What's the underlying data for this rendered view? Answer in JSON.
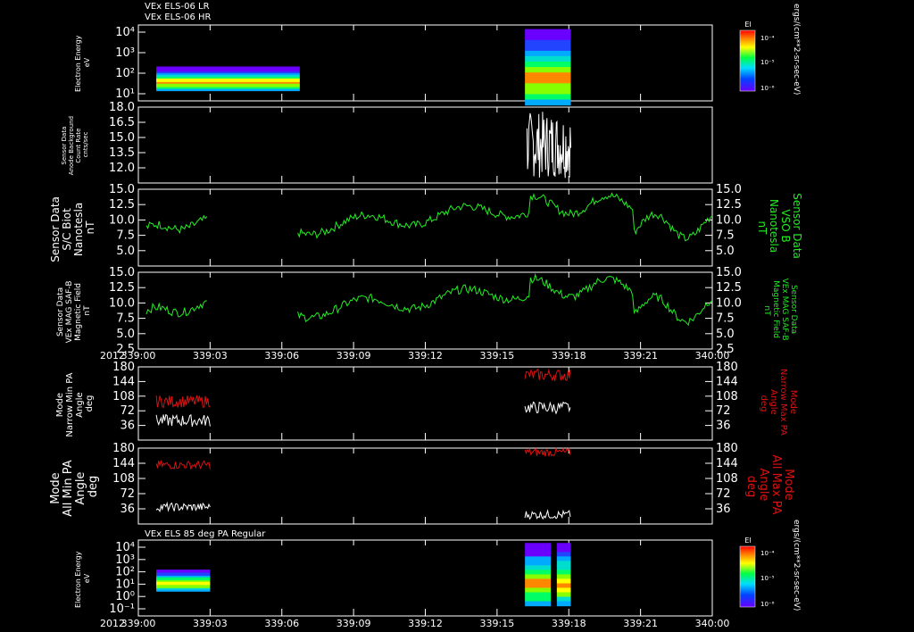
{
  "header": {
    "line1": "VEx ELS-06 LR",
    "line2": "VEx ELS-06 HR"
  },
  "colors": {
    "background": "#000000",
    "axis": "#ffffff",
    "bfield": "#22ee22",
    "min_pa": "#ffffff",
    "max_pa": "#dd1111"
  },
  "time_axis": {
    "year": "2012",
    "ticks": [
      "339:00",
      "339:03",
      "339:06",
      "339:09",
      "339:12",
      "339:15",
      "339:18",
      "339:21",
      "340:00"
    ]
  },
  "chart_data": [
    {
      "id": "spec-top",
      "type": "heatmap",
      "ylabel": [
        "Electron Energy",
        "eV"
      ],
      "ylabel_right": "ergs/(cm**2-sr-sec-eV)",
      "yticks": [
        "10⁴",
        "10³",
        "10²",
        "10¹"
      ],
      "colorbar": {
        "title": "El",
        "ticks": [
          "10⁻⁴",
          "10⁻⁵",
          "10⁻⁶"
        ]
      },
      "blocks": [
        {
          "label": "ELS-06 LR",
          "x_start": "339:00:45",
          "x_end": "339:06:45",
          "energy_range_eV": [
            10,
            150
          ]
        },
        {
          "label": "ELS-06 HR",
          "x_start": "339:16:10",
          "x_end": "339:18:05",
          "energy_range_eV": [
            2,
            10000
          ]
        }
      ]
    },
    {
      "id": "anode-bg",
      "type": "line",
      "ylabel": [
        "Sensor Data",
        "Anode Background",
        "Count Rate",
        "cnts/sec"
      ],
      "yticks": [
        "18.0",
        "16.5",
        "15.0",
        "13.5",
        "12.0"
      ],
      "ylim": [
        10.5,
        18.0
      ],
      "series": [
        {
          "color": "#ffffff",
          "x_range": [
            "339:16:15",
            "339:18:05"
          ],
          "y_range": [
            11.0,
            17.6
          ]
        }
      ]
    },
    {
      "id": "b-scbiot",
      "type": "line",
      "ylabel": [
        "Sensor Data",
        "S/C Biot",
        "Nanotesla",
        "nT"
      ],
      "ylabel_right": [
        "Sensor Data",
        "VSO B",
        "Nanotesla",
        "nT"
      ],
      "yticks": [
        "15.0",
        "12.5",
        "10.0",
        "7.5",
        "5.0"
      ],
      "ylim": [
        2.5,
        15.0
      ],
      "series": [
        {
          "color": "#22ee22",
          "x_range": [
            "339:00:00",
            "340:00:00"
          ],
          "y_range": [
            5.5,
            15.0
          ],
          "gap": [
            "339:02:55",
            "339:06:40"
          ]
        }
      ]
    },
    {
      "id": "b-saf",
      "type": "line",
      "ylabel": [
        "Sensor Data",
        "VEx MAG SAF-B",
        "Magnetic Field",
        "nT"
      ],
      "ylabel_right": [
        "Sensor Data",
        "VEx MAG SAF-B",
        "Magnetic Field",
        "nT"
      ],
      "yticks": [
        "15.0",
        "12.5",
        "10.0",
        "7.5",
        "5.0",
        "2.5"
      ],
      "ylim": [
        2.5,
        15.0
      ],
      "series": [
        {
          "color": "#22ee22",
          "x_range": [
            "339:00:00",
            "340:00:00"
          ],
          "y_range": [
            5.5,
            15.0
          ],
          "gap": [
            "339:02:55",
            "339:06:40"
          ]
        }
      ]
    },
    {
      "id": "pa-narrow",
      "type": "line",
      "ylabel": [
        "Mode",
        "Narrow Min PA",
        "Angle",
        "deg"
      ],
      "ylabel_right": [
        "Mode",
        "Narrow Max PA",
        "Angle",
        "deg"
      ],
      "yticks": [
        "180",
        "144",
        "108",
        "72",
        "36"
      ],
      "ylim": [
        0,
        180
      ],
      "series": [
        {
          "name": "Min PA",
          "color": "#ffffff",
          "x_range": [
            "339:00:45",
            "339:18:05"
          ]
        },
        {
          "name": "Max PA",
          "color": "#dd1111",
          "x_range": [
            "339:00:45",
            "339:18:05"
          ]
        }
      ]
    },
    {
      "id": "pa-all",
      "type": "line",
      "ylabel": [
        "Mode",
        "All Min PA",
        "Angle",
        "deg"
      ],
      "ylabel_right": [
        "Mode",
        "All Max PA",
        "Angle",
        "deg"
      ],
      "yticks": [
        "180",
        "144",
        "108",
        "72",
        "36"
      ],
      "ylim": [
        0,
        180
      ],
      "series": [
        {
          "name": "Min PA",
          "color": "#ffffff",
          "x_range": [
            "339:00:45",
            "339:18:05"
          ]
        },
        {
          "name": "Max PA",
          "color": "#dd1111",
          "x_range": [
            "339:00:45",
            "339:18:05"
          ]
        }
      ]
    },
    {
      "id": "spec-bottom",
      "type": "heatmap",
      "title": "VEx ELS 85 deg PA Regular",
      "ylabel": [
        "Electron Energy",
        "eV"
      ],
      "ylabel_right": "ergs/(cm**2-sr-sec-eV)",
      "yticks": [
        "10⁴",
        "10³",
        "10²",
        "10¹",
        "10⁰",
        "10⁻¹"
      ],
      "colorbar": {
        "title": "El",
        "ticks": [
          "10⁻⁴",
          "10⁻⁵",
          "10⁻⁶"
        ]
      },
      "blocks": [
        {
          "x_start": "339:00:45",
          "x_end": "339:03:00",
          "energy_range_eV": [
            5,
            150
          ]
        },
        {
          "x_start": "339:16:10",
          "x_end": "339:17:15",
          "energy_range_eV": [
            0.5,
            10000
          ]
        },
        {
          "x_start": "339:17:30",
          "x_end": "339:18:05",
          "energy_range_eV": [
            0.5,
            10000
          ]
        }
      ]
    }
  ]
}
